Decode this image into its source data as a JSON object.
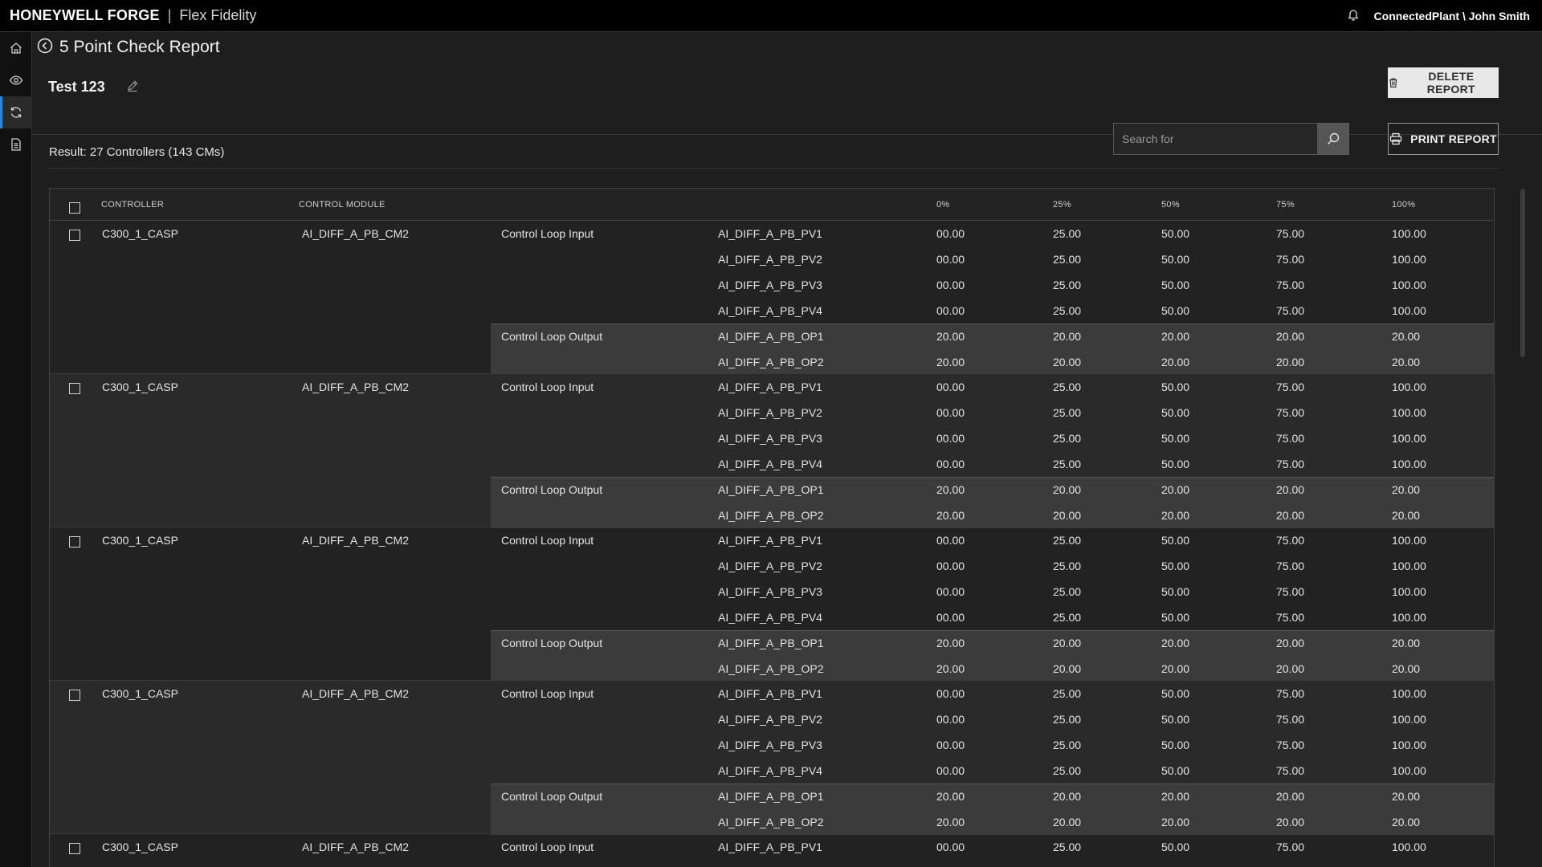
{
  "topbar": {
    "brand": "HONEYWELL FORGE",
    "separator": "|",
    "product": "Flex Fidelity",
    "user": "ConnectedPlant \\ John Smith",
    "bell_icon": "bell-icon"
  },
  "sidenav": {
    "items": [
      {
        "name": "home-icon",
        "active": false
      },
      {
        "name": "eye-icon",
        "active": false
      },
      {
        "name": "sync-icon",
        "active": true
      },
      {
        "name": "document-icon",
        "active": false
      }
    ]
  },
  "page": {
    "title": "5 Point Check Report",
    "report_name": "Test 123",
    "delete_label": "DELETE REPORT",
    "print_label": "PRINT REPORT",
    "search_placeholder": "Search for",
    "result_text": "Result: 27 Controllers  (143 CMs)"
  },
  "table": {
    "headers": {
      "controller": "CONTROLLER",
      "control_module": "CONTROL MODULE",
      "p0": "0%",
      "p25": "25%",
      "p50": "50%",
      "p75": "75%",
      "p100": "100%"
    },
    "groups": [
      {
        "controller": "C300_1_CASP",
        "module": "AI_DIFF_A_PB_CM2",
        "input_label": "Control Loop Input",
        "output_label": "Control Loop Output",
        "inputs": [
          {
            "tag": "AI_DIFF_A_PB_PV1",
            "v": [
              "00.00",
              "25.00",
              "50.00",
              "75.00",
              "100.00"
            ]
          },
          {
            "tag": "AI_DIFF_A_PB_PV2",
            "v": [
              "00.00",
              "25.00",
              "50.00",
              "75.00",
              "100.00"
            ]
          },
          {
            "tag": "AI_DIFF_A_PB_PV3",
            "v": [
              "00.00",
              "25.00",
              "50.00",
              "75.00",
              "100.00"
            ]
          },
          {
            "tag": "AI_DIFF_A_PB_PV4",
            "v": [
              "00.00",
              "25.00",
              "50.00",
              "75.00",
              "100.00"
            ]
          }
        ],
        "outputs": [
          {
            "tag": "AI_DIFF_A_PB_OP1",
            "v": [
              "20.00",
              "20.00",
              "20.00",
              "20.00",
              "20.00"
            ]
          },
          {
            "tag": "AI_DIFF_A_PB_OP2",
            "v": [
              "20.00",
              "20.00",
              "20.00",
              "20.00",
              "20.00"
            ]
          }
        ]
      },
      {
        "controller": "C300_1_CASP",
        "module": "AI_DIFF_A_PB_CM2",
        "input_label": "Control Loop Input",
        "output_label": "Control Loop Output",
        "inputs": [
          {
            "tag": "AI_DIFF_A_PB_PV1",
            "v": [
              "00.00",
              "25.00",
              "50.00",
              "75.00",
              "100.00"
            ]
          },
          {
            "tag": "AI_DIFF_A_PB_PV2",
            "v": [
              "00.00",
              "25.00",
              "50.00",
              "75.00",
              "100.00"
            ]
          },
          {
            "tag": "AI_DIFF_A_PB_PV3",
            "v": [
              "00.00",
              "25.00",
              "50.00",
              "75.00",
              "100.00"
            ]
          },
          {
            "tag": "AI_DIFF_A_PB_PV4",
            "v": [
              "00.00",
              "25.00",
              "50.00",
              "75.00",
              "100.00"
            ]
          }
        ],
        "outputs": [
          {
            "tag": "AI_DIFF_A_PB_OP1",
            "v": [
              "20.00",
              "20.00",
              "20.00",
              "20.00",
              "20.00"
            ]
          },
          {
            "tag": "AI_DIFF_A_PB_OP2",
            "v": [
              "20.00",
              "20.00",
              "20.00",
              "20.00",
              "20.00"
            ]
          }
        ]
      },
      {
        "controller": "C300_1_CASP",
        "module": "AI_DIFF_A_PB_CM2",
        "input_label": "Control Loop Input",
        "output_label": "Control Loop Output",
        "inputs": [
          {
            "tag": "AI_DIFF_A_PB_PV1",
            "v": [
              "00.00",
              "25.00",
              "50.00",
              "75.00",
              "100.00"
            ]
          },
          {
            "tag": "AI_DIFF_A_PB_PV2",
            "v": [
              "00.00",
              "25.00",
              "50.00",
              "75.00",
              "100.00"
            ]
          },
          {
            "tag": "AI_DIFF_A_PB_PV3",
            "v": [
              "00.00",
              "25.00",
              "50.00",
              "75.00",
              "100.00"
            ]
          },
          {
            "tag": "AI_DIFF_A_PB_PV4",
            "v": [
              "00.00",
              "25.00",
              "50.00",
              "75.00",
              "100.00"
            ]
          }
        ],
        "outputs": [
          {
            "tag": "AI_DIFF_A_PB_OP1",
            "v": [
              "20.00",
              "20.00",
              "20.00",
              "20.00",
              "20.00"
            ]
          },
          {
            "tag": "AI_DIFF_A_PB_OP2",
            "v": [
              "20.00",
              "20.00",
              "20.00",
              "20.00",
              "20.00"
            ]
          }
        ]
      },
      {
        "controller": "C300_1_CASP",
        "module": "AI_DIFF_A_PB_CM2",
        "input_label": "Control Loop Input",
        "output_label": "Control Loop Output",
        "inputs": [
          {
            "tag": "AI_DIFF_A_PB_PV1",
            "v": [
              "00.00",
              "25.00",
              "50.00",
              "75.00",
              "100.00"
            ]
          },
          {
            "tag": "AI_DIFF_A_PB_PV2",
            "v": [
              "00.00",
              "25.00",
              "50.00",
              "75.00",
              "100.00"
            ]
          },
          {
            "tag": "AI_DIFF_A_PB_PV3",
            "v": [
              "00.00",
              "25.00",
              "50.00",
              "75.00",
              "100.00"
            ]
          },
          {
            "tag": "AI_DIFF_A_PB_PV4",
            "v": [
              "00.00",
              "25.00",
              "50.00",
              "75.00",
              "100.00"
            ]
          }
        ],
        "outputs": [
          {
            "tag": "AI_DIFF_A_PB_OP1",
            "v": [
              "20.00",
              "20.00",
              "20.00",
              "20.00",
              "20.00"
            ]
          },
          {
            "tag": "AI_DIFF_A_PB_OP2",
            "v": [
              "20.00",
              "20.00",
              "20.00",
              "20.00",
              "20.00"
            ]
          }
        ]
      },
      {
        "controller": "C300_1_CASP",
        "module": "AI_DIFF_A_PB_CM2",
        "input_label": "Control Loop Input",
        "output_label": "",
        "inputs": [
          {
            "tag": "AI_DIFF_A_PB_PV1",
            "v": [
              "00.00",
              "25.00",
              "50.00",
              "75.00",
              "100.00"
            ]
          }
        ],
        "outputs": []
      }
    ]
  }
}
